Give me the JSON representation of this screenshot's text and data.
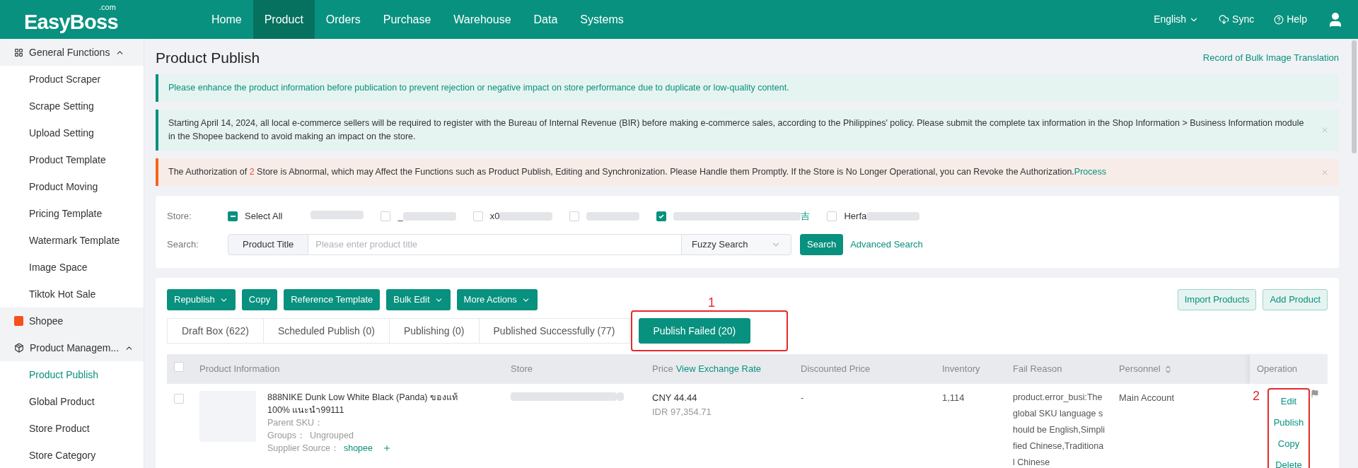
{
  "nav": {
    "logo": "EasyBoss",
    "logo_suffix": ".com",
    "items": [
      {
        "label": "Home",
        "selected": false
      },
      {
        "label": "Product",
        "selected": true
      },
      {
        "label": "Orders",
        "selected": false
      },
      {
        "label": "Purchase",
        "selected": false
      },
      {
        "label": "Warehouse",
        "selected": false
      },
      {
        "label": "Data",
        "selected": false
      },
      {
        "label": "Systems",
        "selected": false
      }
    ],
    "language": "English",
    "sync": "Sync",
    "help": "Help"
  },
  "sidebar": [
    {
      "kind": "group",
      "label": "General Functions",
      "expanded": true,
      "children": [
        {
          "label": "Product Scraper",
          "selected": false
        },
        {
          "label": "Scrape Setting",
          "selected": false
        },
        {
          "label": "Upload Setting",
          "selected": false
        },
        {
          "label": "Product Template",
          "selected": false
        },
        {
          "label": "Product Moving",
          "selected": false
        },
        {
          "label": "Pricing Template",
          "selected": false
        },
        {
          "label": "Watermark Template",
          "selected": false
        },
        {
          "label": "Image Space",
          "selected": false
        },
        {
          "label": "Tiktok Hot Sale",
          "selected": false
        }
      ]
    },
    {
      "kind": "shop",
      "label": "Shopee"
    },
    {
      "kind": "group",
      "label": "Product Managem...",
      "expanded": true,
      "children": [
        {
          "label": "Product Publish",
          "selected": true
        },
        {
          "label": "Global Product",
          "selected": false
        },
        {
          "label": "Store Product",
          "selected": false
        },
        {
          "label": "Store Category",
          "selected": false
        }
      ]
    }
  ],
  "page": {
    "title": "Product Publish",
    "link": "Record of Bulk Image Translation"
  },
  "notices": [
    {
      "kind": "info",
      "text": "Please enhance the product information before publication to prevent rejection or negative impact on store performance due to duplicate or low-quality content.",
      "closable": false
    },
    {
      "kind": "plain",
      "text": "Starting April 14, 2024, all local e-commerce sellers will be required to register with the Bureau of Internal Revenue (BIR) before making e-commerce sales, according to the Philippines' policy. Please submit the complete tax information in the Shop Information > Business Information module in the Shopee backend to avoid making an impact on the store.",
      "closable": true
    },
    {
      "kind": "warning",
      "text_before": "The Authorization of ",
      "count": "2",
      "text_after": " Store is Abnormal, which may Affect the Functions such as Product Publish, Editing and Synchronization. Please Handle them Promptly. If the Store is No Longer Operational, you can Revoke the Authorization.",
      "link": "Process",
      "closable": true
    }
  ],
  "filter": {
    "store_label": "Store:",
    "select_all": {
      "label": "Select All",
      "indeterminate": true
    },
    "stores": [
      {
        "prefix": "_",
        "checked": false
      },
      {
        "prefix": "x0",
        "checked": false
      },
      {
        "checked": false
      },
      {
        "suffix": "吉",
        "checked": true
      },
      {
        "prefix": "Herfa",
        "checked": false
      }
    ],
    "search_label": "Search:",
    "field_type": "Product Title",
    "placeholder": "Please enter product title",
    "mode": "Fuzzy Search",
    "search_button": "Search",
    "advanced": "Advanced Search"
  },
  "toolbar": {
    "actions": [
      {
        "label": "Republish",
        "dropdown": true
      },
      {
        "label": "Copy",
        "dropdown": false
      },
      {
        "label": "Reference Template",
        "dropdown": false
      },
      {
        "label": "Bulk Edit",
        "dropdown": true
      },
      {
        "label": "More Actions",
        "dropdown": true
      }
    ],
    "right": [
      "Import Products",
      "Add Product"
    ]
  },
  "tabs": [
    {
      "label": "Draft Box (622)",
      "selected": false
    },
    {
      "label": "Scheduled Publish (0)",
      "selected": false
    },
    {
      "label": "Publishing (0)",
      "selected": false
    },
    {
      "label": "Published Successfully (77)",
      "selected": false
    },
    {
      "label": "Publish Failed (20)",
      "selected": true
    }
  ],
  "table": {
    "header_checked": false,
    "columns": [
      {
        "label": "Product Information"
      },
      {
        "label": "Store"
      },
      {
        "label": "Price",
        "link": "View Exchange Rate"
      },
      {
        "label": "Discounted Price"
      },
      {
        "label": "Inventory"
      },
      {
        "label": "Fail Reason"
      },
      {
        "label": "Personnel",
        "sortable": true
      },
      {
        "label": "Operation"
      }
    ],
    "rows": [
      {
        "checked": false,
        "title": "888NIKE Dunk Low White Black (Panda) ของแท้ 100% แนะนำ99111",
        "parent_sku": "Parent SKU：",
        "groups_label": "Groups：",
        "groups": "Ungrouped",
        "supplier_label": "Supplier Source：",
        "supplier": "shopee",
        "price": "CNY 44.44",
        "price_alt": "IDR 97,354.71",
        "discounted": "-",
        "inventory": "1,114",
        "fail_reason": "product.error_busi:The global SKU language should be English,Simplified Chinese,Traditional Chinese",
        "personnel": "Main Account",
        "operations": [
          "Edit",
          "Publish",
          "Copy",
          "Delete"
        ]
      }
    ]
  },
  "annotations": [
    "1",
    "2"
  ]
}
